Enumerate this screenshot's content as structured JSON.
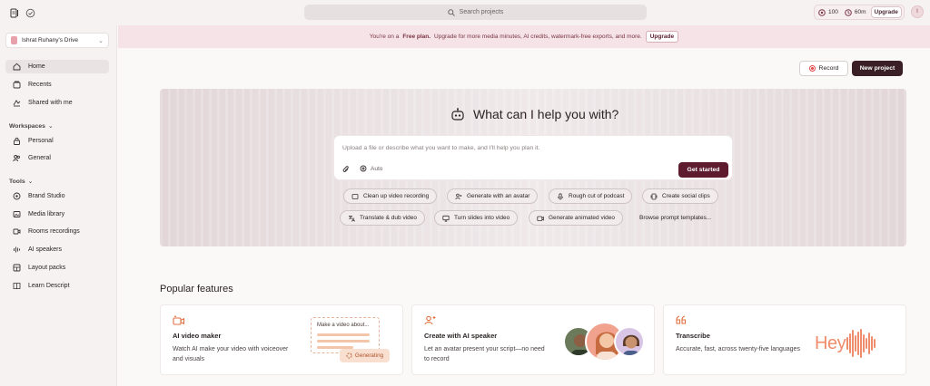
{
  "topbar": {
    "search_placeholder": "Search projects",
    "credits_count": "100",
    "minutes": "60m",
    "upgrade_label": "Upgrade",
    "avatar_initial": "I"
  },
  "sidebar": {
    "drive_name": "Ishrat Ruhany's Drive",
    "nav": [
      {
        "label": "Home",
        "icon": "home-icon",
        "active": true
      },
      {
        "label": "Recents",
        "icon": "recents-icon"
      },
      {
        "label": "Shared with me",
        "icon": "shared-icon"
      }
    ],
    "workspaces_label": "Workspaces",
    "workspaces": [
      {
        "label": "Personal",
        "icon": "lock-icon"
      },
      {
        "label": "General",
        "icon": "people-icon"
      }
    ],
    "tools_label": "Tools",
    "tools": [
      {
        "label": "Brand Studio",
        "icon": "brand-studio-icon"
      },
      {
        "label": "Media library",
        "icon": "media-library-icon"
      },
      {
        "label": "Rooms recordings",
        "icon": "rooms-icon"
      },
      {
        "label": "AI speakers",
        "icon": "ai-speakers-icon"
      },
      {
        "label": "Layout packs",
        "icon": "layout-packs-icon"
      },
      {
        "label": "Learn Descript",
        "icon": "book-icon"
      }
    ]
  },
  "banner": {
    "prefix": "You're on a",
    "plan": "Free plan.",
    "message": "Upgrade for more media minutes, AI credits, watermark-free exports, and more.",
    "button": "Upgrade"
  },
  "actions": {
    "record_label": "Record",
    "new_project_label": "New project"
  },
  "hero": {
    "title": "What can I help you with?",
    "placeholder": "Upload a file or describe what you want to make, and I'll help you plan it.",
    "mode_label": "Auto",
    "submit_label": "Get started",
    "chips_row1": [
      "Clean up video recording",
      "Generate with an avatar",
      "Rough cut of podcast",
      "Create social clips"
    ],
    "chips_row2": [
      "Translate & dub video",
      "Turn slides into video",
      "Generate animated video",
      "Browse prompt templates..."
    ]
  },
  "popular": {
    "heading": "Popular features",
    "cards": [
      {
        "title": "AI video maker",
        "desc": "Watch AI make your video with voiceover and visuals",
        "icon": "video-spark-icon",
        "preview_label": "Make a video about...",
        "badge": "Generating"
      },
      {
        "title": "Create with AI speaker",
        "desc": "Let an avatar present your script—no need to record",
        "icon": "person-plus-icon"
      },
      {
        "title": "Transcribe",
        "desc": "Accurate, fast, across twenty-five languages",
        "icon": "quote-icon",
        "preview_word": "Hey"
      }
    ]
  },
  "colors": {
    "accent": "#5e1b2e",
    "banner_bg": "#f5e3e7",
    "orange": "#ef8c6b"
  }
}
